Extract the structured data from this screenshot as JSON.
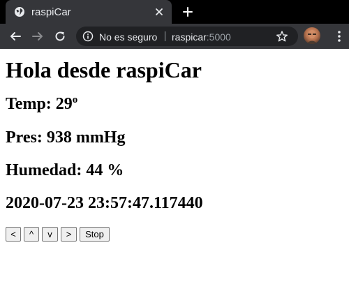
{
  "browser": {
    "tab": {
      "title": "raspiCar"
    },
    "address": {
      "security_text": "No es seguro",
      "host": "raspicar",
      "port": ":5000"
    },
    "icons": {
      "back": "back-arrow-icon",
      "forward": "forward-arrow-icon",
      "reload": "reload-icon",
      "info": "info-icon",
      "bookmark": "star-icon",
      "menu": "kebab-menu-icon",
      "new_tab": "plus-icon",
      "close": "close-icon"
    },
    "colors": {
      "tabstrip": "#000000",
      "toolbar": "#35363a",
      "omnibox": "#202124"
    }
  },
  "page": {
    "title": "Hola desde raspiCar",
    "temp_label": "Temp: 29",
    "temp_unit": "o",
    "pressure": "Pres: 938 mmHg",
    "humidity": "Humedad: 44 %",
    "timestamp": "2020-07-23 23:57:47.117440",
    "buttons": {
      "left": "<",
      "up": "^",
      "down": "v",
      "right": ">",
      "stop": "Stop"
    }
  }
}
